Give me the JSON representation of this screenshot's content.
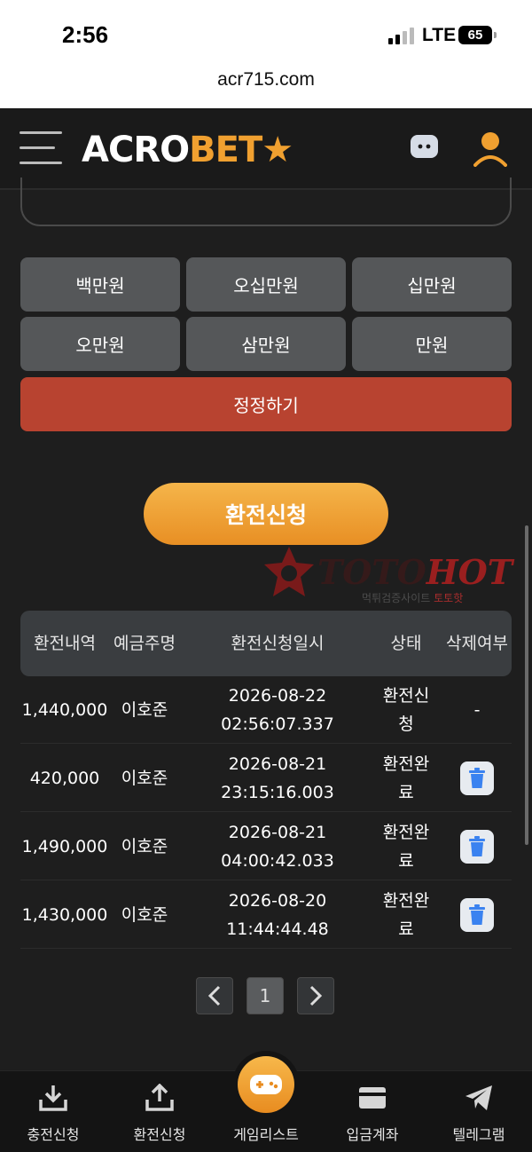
{
  "status_bar": {
    "time": "2:56",
    "network": "LTE",
    "battery": "65",
    "url": "acr715.com"
  },
  "header": {
    "logo_part1": "ACRO",
    "logo_part2": "BET"
  },
  "amount_buttons": [
    {
      "label": "백만원"
    },
    {
      "label": "오십만원"
    },
    {
      "label": "십만원"
    },
    {
      "label": "오만원"
    },
    {
      "label": "삼만원"
    },
    {
      "label": "만원"
    }
  ],
  "reset_label": "정정하기",
  "apply_label": "환전신청",
  "watermark": {
    "brand_a": "TOTO",
    "brand_b": "HOT",
    "sub_a": "먹튀검증사이트",
    "sub_b": "토토핫"
  },
  "table": {
    "headers": [
      "환전내역",
      "예금주명",
      "환전신청일시",
      "상태",
      "삭제여부"
    ],
    "rows": [
      {
        "amount": "1,440,000",
        "name": "이호준",
        "date": "2026-08-22",
        "time": "02:56:07.337",
        "status_a": "환전신",
        "status_b": "청",
        "delete": "-"
      },
      {
        "amount": "420,000",
        "name": "이호준",
        "date": "2026-08-21",
        "time": "23:15:16.003",
        "status_a": "환전완",
        "status_b": "료",
        "delete": ""
      },
      {
        "amount": "1,490,000",
        "name": "이호준",
        "date": "2026-08-21",
        "time": "04:00:42.033",
        "status_a": "환전완",
        "status_b": "료",
        "delete": ""
      },
      {
        "amount": "1,430,000",
        "name": "이호준",
        "date": "2026-08-20",
        "time": "11:44:44.48",
        "status_a": "환전완",
        "status_b": "료",
        "delete": ""
      }
    ]
  },
  "pagination": {
    "current": "1"
  },
  "bottom_nav": [
    {
      "label": "충전신청"
    },
    {
      "label": "환전신청"
    },
    {
      "label": "게임리스트"
    },
    {
      "label": "입금계좌"
    },
    {
      "label": "텔레그램"
    }
  ],
  "colors": {
    "accent": "#f0a030",
    "reset": "#b84330",
    "button": "#555759",
    "trash": "#3a82f0"
  }
}
